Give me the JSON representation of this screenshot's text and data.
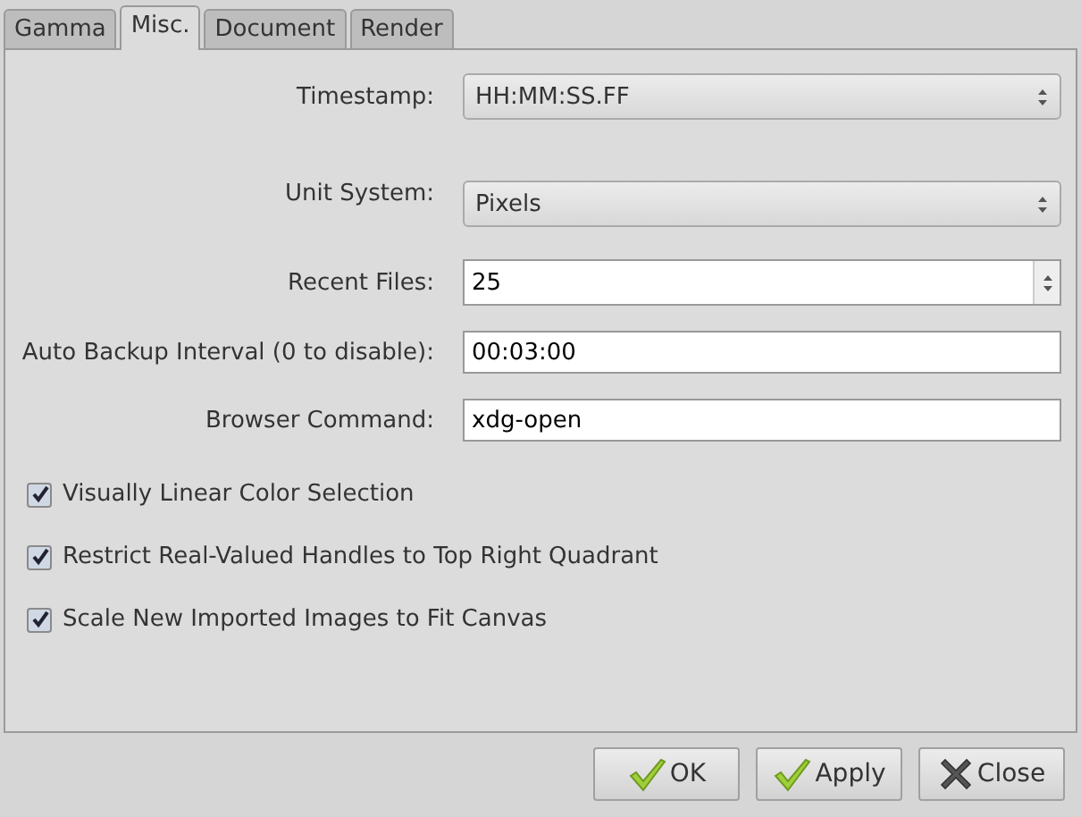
{
  "tabs": [
    {
      "label": "Gamma",
      "selected": false
    },
    {
      "label": "Misc.",
      "selected": true
    },
    {
      "label": "Document",
      "selected": false
    },
    {
      "label": "Render",
      "selected": false
    }
  ],
  "fields": [
    {
      "label": "Timestamp:",
      "kind": "combo",
      "value": "HH:MM:SS.FF"
    },
    {
      "label": "Unit System:",
      "kind": "combo",
      "value": "Pixels"
    },
    {
      "label": "Recent Files:",
      "kind": "spin",
      "value": "25"
    },
    {
      "label": "Auto Backup Interval (0 to disable):",
      "kind": "entry",
      "value": "00:03:00"
    },
    {
      "label": "Browser Command:",
      "kind": "entry",
      "value": "xdg-open"
    }
  ],
  "checkboxes": [
    {
      "label": "Visually Linear Color Selection",
      "checked": true
    },
    {
      "label": "Restrict Real-Valued Handles to Top Right Quadrant",
      "checked": true
    },
    {
      "label": "Scale New Imported Images to Fit Canvas",
      "checked": true
    }
  ],
  "buttons": [
    {
      "label": "OK",
      "kind": "ok"
    },
    {
      "label": "Apply",
      "kind": "ok"
    },
    {
      "label": "Close",
      "kind": "close"
    }
  ]
}
